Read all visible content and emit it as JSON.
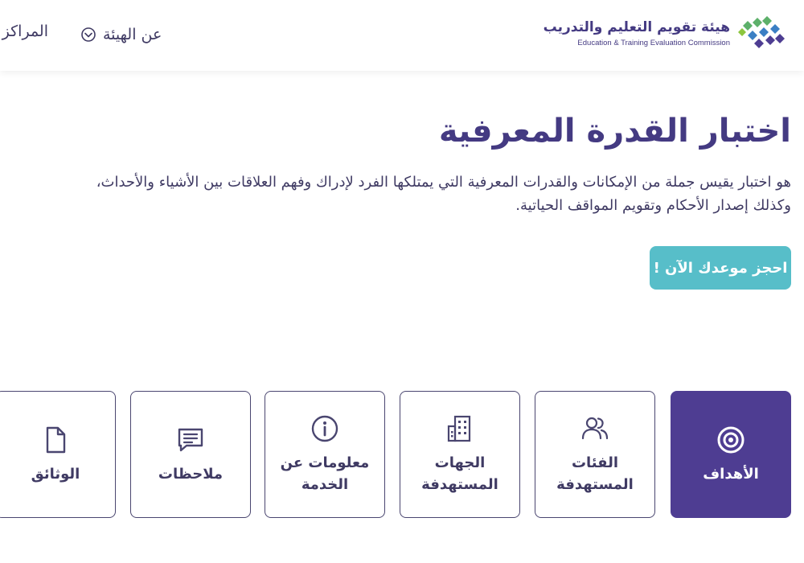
{
  "header": {
    "logo_ar": "هيئة تقويم التعليم والتدريب",
    "logo_en": "Education & Training Evaluation Commission",
    "nav": {
      "about": "عن الهيئة",
      "centers": "المراكز"
    }
  },
  "main": {
    "title": "اختبار القدرة المعرفية",
    "description": "هو اختبار يقيس جملة من الإمكانات والقدرات المعرفية التي يمتلكها الفرد لإدراك وفهم العلاقات بين الأشياء والأحداث، وكذلك إصدار الأحكام وتقويم المواقف الحياتية.",
    "book_button": "احجز موعدك الآن !"
  },
  "tabs": [
    {
      "label": "الأهداف",
      "icon": "target-icon",
      "active": true
    },
    {
      "label": "الفئات المستهدفة",
      "icon": "users-icon",
      "active": false
    },
    {
      "label": "الجهات المستهدفة",
      "icon": "building-icon",
      "active": false
    },
    {
      "label": "معلومات عن الخدمة",
      "icon": "info-icon",
      "active": false
    },
    {
      "label": "ملاحظات",
      "icon": "comment-icon",
      "active": false
    },
    {
      "label": "الوثائق",
      "icon": "document-icon",
      "active": false
    }
  ],
  "colors": {
    "primary": "#4e3d92",
    "accent": "#57bec9",
    "text": "#3f3a63",
    "logo_green": "#5db06a",
    "logo_blue": "#3b7fc4"
  }
}
